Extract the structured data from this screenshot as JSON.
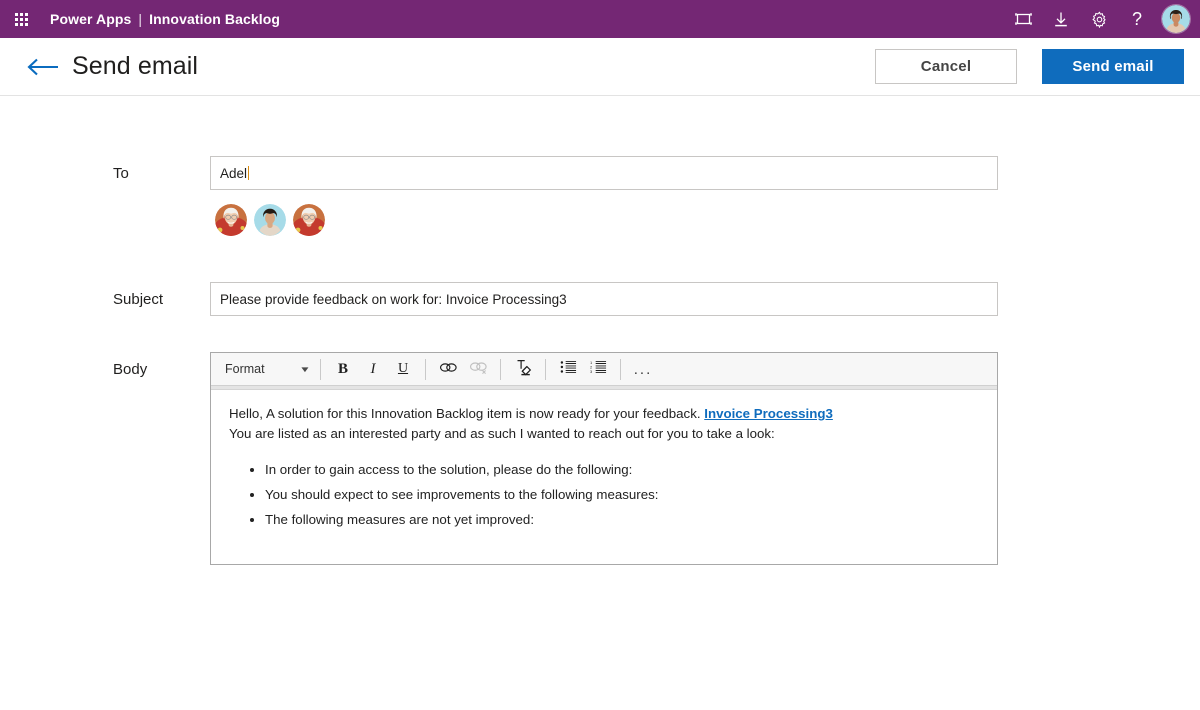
{
  "suitebar": {
    "waffle_icon": "waffle-grid-icon",
    "product": "Power Apps",
    "separator": "|",
    "app_name": "Innovation Backlog",
    "icons": [
      {
        "name": "fit-to-screen-icon",
        "label": "Fit to screen"
      },
      {
        "name": "download-icon",
        "label": "Download"
      },
      {
        "name": "gear-icon",
        "label": "Settings"
      },
      {
        "name": "help-icon",
        "label": "?"
      }
    ],
    "avatar": "user-avatar"
  },
  "commandbar": {
    "back_icon": "back-arrow-icon",
    "title": "Send email",
    "cancel_label": "Cancel",
    "send_label": "Send email"
  },
  "form": {
    "to": {
      "label": "To",
      "value": "Adel",
      "placeholder": "",
      "suggestions_count": 3
    },
    "subject": {
      "label": "Subject",
      "value": "Please provide feedback on work for: Invoice Processing3",
      "placeholder": ""
    },
    "body": {
      "label": "Body",
      "toolbar": {
        "format_label": "Format",
        "bold_label": "B",
        "italic_label": "I",
        "underline_label": "U",
        "link_icon": "link-icon",
        "unlink_icon": "unlink-icon",
        "clear_format_icon": "clear-formatting-icon",
        "bullet_list_icon": "bullet-list-icon",
        "numbered_list_icon": "numbered-list-icon",
        "more_label": "..."
      },
      "content": {
        "line1_prefix": "Hello, A solution for this Innovation Backlog item is now ready for your feedback. ",
        "line1_link": "Invoice Processing3",
        "line2": "You are listed as an interested party and as such I wanted to reach out for you to take a look:",
        "bullets": [
          "In order to gain access to the solution, please do the following:",
          "You should expect to see improvements to the following measures:",
          "The following measures are not yet improved:"
        ]
      }
    }
  },
  "colors": {
    "suitebar_purple": "#742774",
    "primary_blue": "#0f6cbd",
    "link_blue": "#0f6cbd",
    "caret_amber": "#d98c10",
    "border_grey": "#c8c6c4"
  }
}
